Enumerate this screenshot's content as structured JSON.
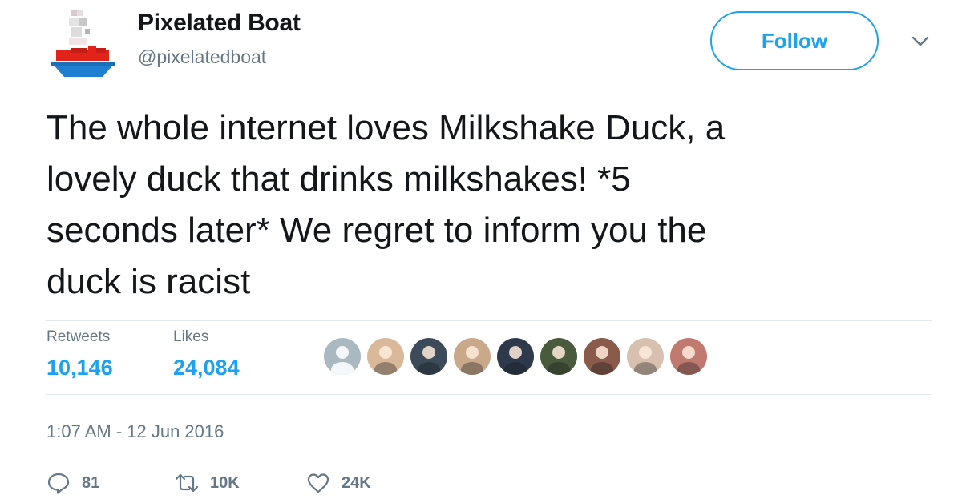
{
  "user": {
    "name": "Pixelated Boat",
    "handle": "@pixelatedboat"
  },
  "follow_label": "Follow",
  "tweet": {
    "text_lines": [
      "The whole internet loves Milkshake Duck, a",
      "lovely duck that drinks milkshakes! *5",
      "seconds later* We regret to inform you the",
      "duck is racist"
    ]
  },
  "stats": {
    "retweets_label": "Retweets",
    "retweets_value": "10,146",
    "likes_label": "Likes",
    "likes_value": "24,084"
  },
  "likers": [
    {
      "icon": "default-avatar",
      "color": "#b8c0c8"
    },
    {
      "icon": "user-avatar",
      "color": "#d9b99a"
    },
    {
      "icon": "user-avatar",
      "color": "#3c4a5a"
    },
    {
      "icon": "user-avatar",
      "color": "#c9a98a"
    },
    {
      "icon": "user-avatar",
      "color": "#2e3a4c"
    },
    {
      "icon": "user-avatar",
      "color": "#4a5a3c"
    },
    {
      "icon": "user-avatar",
      "color": "#8a5a4a"
    },
    {
      "icon": "user-avatar",
      "color": "#d8c0b0"
    },
    {
      "icon": "user-avatar",
      "color": "#c07a70"
    }
  ],
  "timestamp": "1:07 AM - 12 Jun 2016",
  "actions": {
    "reply_count": "81",
    "retweet_count": "10K",
    "like_count": "24K"
  },
  "colors": {
    "accent": "#1da1f2",
    "secondary_text": "#657786",
    "divider": "#e1e8ed"
  }
}
